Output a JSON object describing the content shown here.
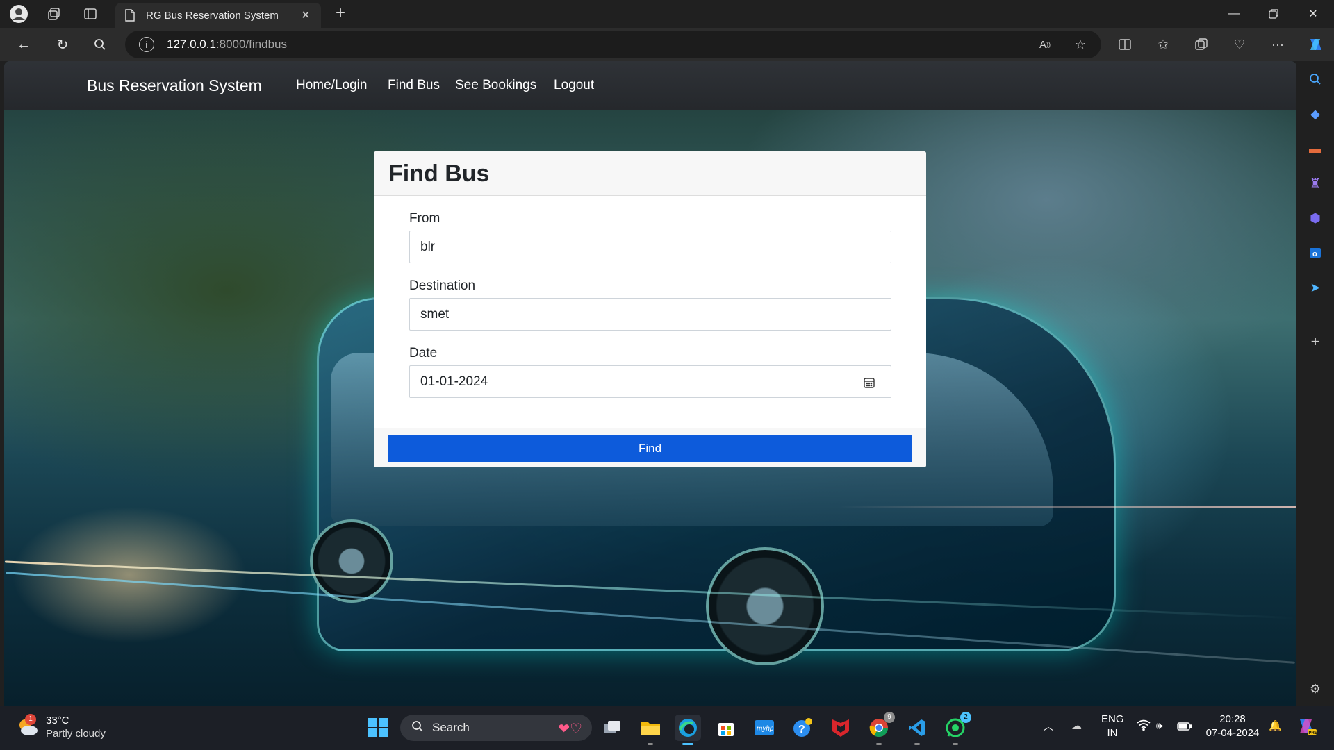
{
  "browser": {
    "tab_title": "RG Bus Reservation System",
    "url_host": "127.0.0.1",
    "url_path": ":8000/findbus"
  },
  "app": {
    "brand": "Bus Reservation System",
    "nav": [
      "Home/Login",
      "Find Bus",
      "See Bookings",
      "Logout"
    ]
  },
  "form": {
    "title": "Find Bus",
    "from_label": "From",
    "from_value": "blr",
    "destination_label": "Destination",
    "destination_value": "smet",
    "date_label": "Date",
    "date_value": "01-01-2024",
    "submit_label": "Find"
  },
  "taskbar": {
    "weather_temp": "33°C",
    "weather_desc": "Partly cloudy",
    "weather_badge": "1",
    "search_label": "Search",
    "chrome_badge": "9",
    "whatsapp_badge": "2",
    "lang_line1": "ENG",
    "lang_line2": "IN",
    "time": "20:28",
    "date": "07-04-2024"
  },
  "colors": {
    "primary_button": "#0d5bdb",
    "navbar": "#2f3237"
  }
}
